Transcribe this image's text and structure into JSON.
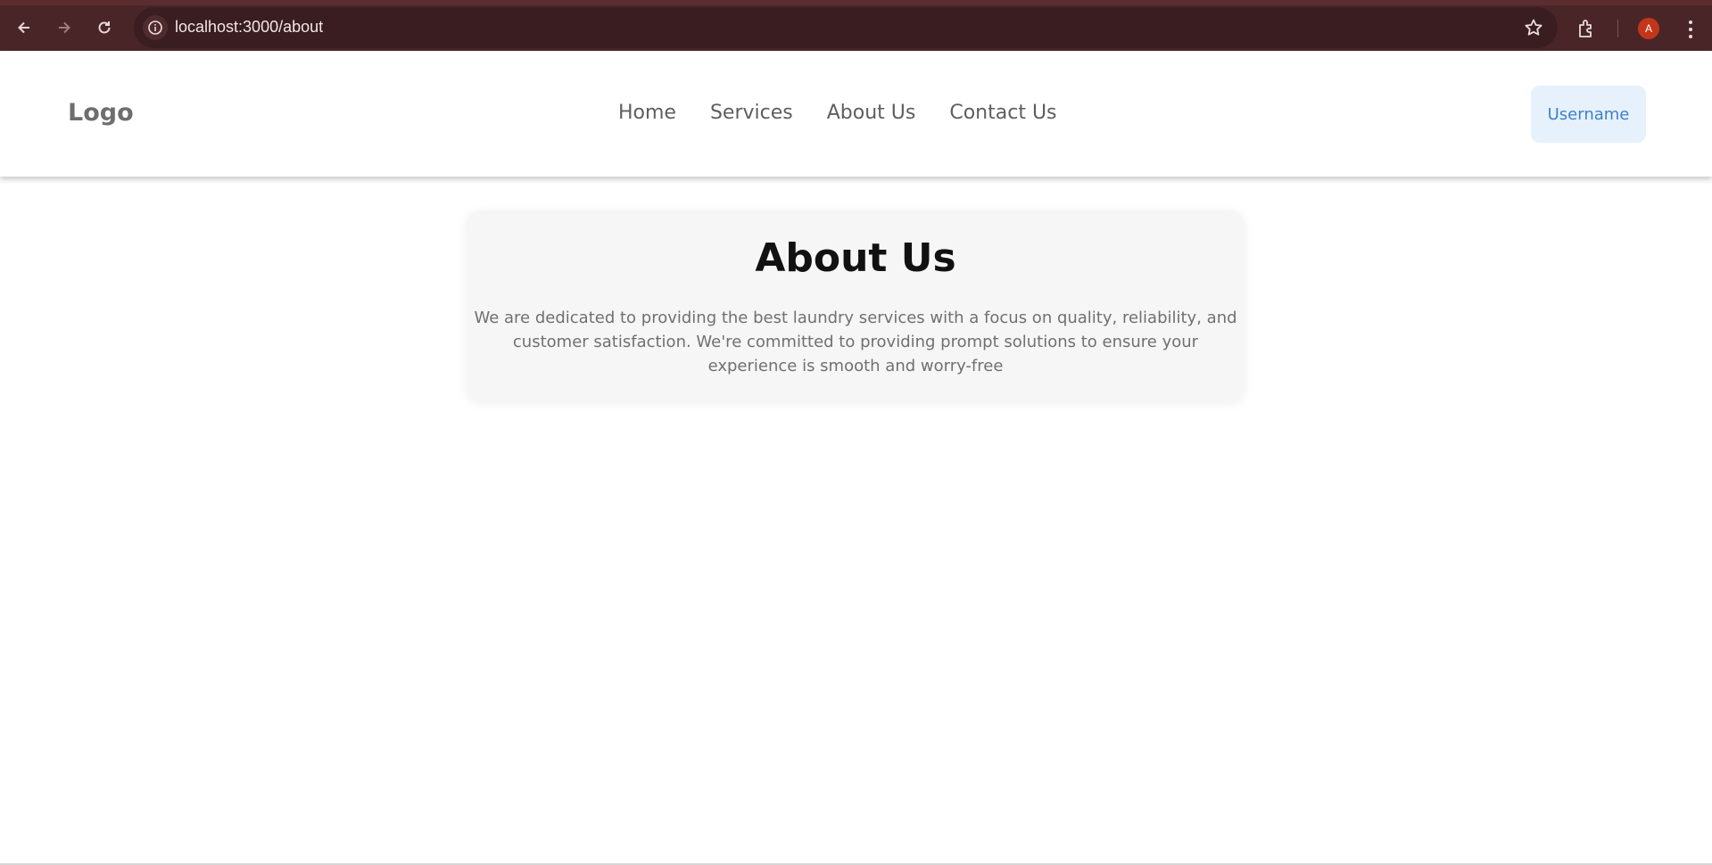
{
  "browser": {
    "url": "localhost:3000/about",
    "profile_initial": "A",
    "icons": [
      "back-icon",
      "forward-icon",
      "reload-icon",
      "info-icon",
      "star-icon",
      "extensions-icon",
      "kebab-menu-icon"
    ]
  },
  "header": {
    "logo": "Logo",
    "nav": [
      {
        "label": "Home"
      },
      {
        "label": "Services"
      },
      {
        "label": "About Us"
      },
      {
        "label": "Contact Us"
      }
    ],
    "user_button": "Username"
  },
  "about": {
    "title": "About Us",
    "text": "We are dedicated to providing the best laundry services with a focus on quality, reliability, and customer satisfaction. We're committed to providing prompt solutions to ensure your experience is smooth and worry-free"
  },
  "colors": {
    "chrome_bg": "#4a2528",
    "omnibox_bg": "#3a1d20",
    "accent_blue": "#3d82c9",
    "user_button_bg": "#e6f1fc",
    "card_bg": "#f6f6f6",
    "avatar_bg": "#c4361a"
  }
}
